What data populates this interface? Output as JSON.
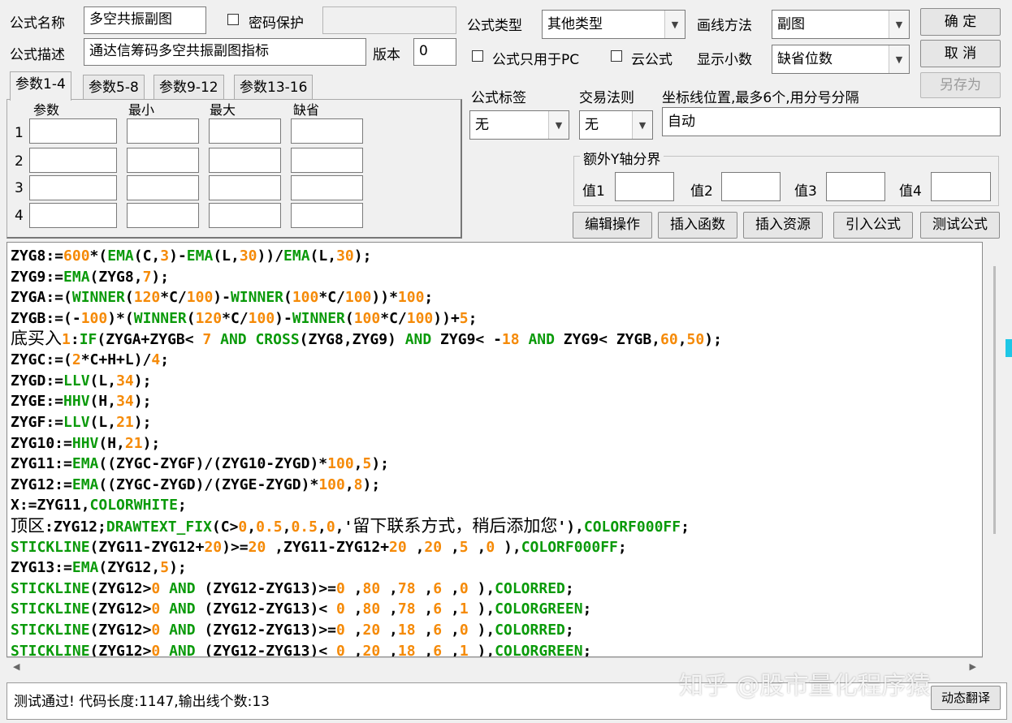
{
  "formula": {
    "name_label": "公式名称",
    "name_value": "多空共振副图",
    "password_label": "密码保护",
    "desc_label": "公式描述",
    "desc_value": "通达信筹码多空共振副图指标",
    "version_label": "版本",
    "version_value": "0",
    "type_label": "公式类型",
    "type_value": "其他类型",
    "draw_label": "画线方法",
    "draw_value": "副图",
    "pc_only_label": "公式只用于PC",
    "cloud_label": "云公式",
    "decimals_label": "显示小数",
    "decimals_value": "缺省位数",
    "tag_label": "公式标签",
    "tag_value": "无",
    "rule_label": "交易法则",
    "rule_value": "无",
    "axis_label": "坐标线位置,最多6个,用分号分隔",
    "axis_value": "自动",
    "yaxis_group": "额外Y轴分界",
    "y1": "值1",
    "y2": "值2",
    "y3": "值3",
    "y4": "值4"
  },
  "buttons": {
    "ok": "确 定",
    "cancel": "取 消",
    "save_as": "另存为",
    "edit": "编辑操作",
    "insert_func": "插入函数",
    "insert_res": "插入资源",
    "import": "引入公式",
    "test": "测试公式",
    "dynamic": "动态翻译"
  },
  "params": {
    "tabs": [
      "参数1-4",
      "参数5-8",
      "参数9-12",
      "参数13-16"
    ],
    "headers": [
      "参数",
      "最小",
      "最大",
      "缺省"
    ],
    "rows": [
      "1",
      "2",
      "3",
      "4"
    ]
  },
  "status": "测试通过! 代码长度:1147,输出线个数:13",
  "watermark": "知乎 @股市量化程序猿",
  "colors": {
    "keyword": "#0a9a0a",
    "number": "#f58a07"
  },
  "code": [
    "ZYG8:=600*(EMA(C,3)-EMA(L,30))/EMA(L,30);",
    "ZYG9:=EMA(ZYG8,7);",
    "ZYGA:=(WINNER(120*C/100)-WINNER(100*C/100))*100;",
    "ZYGB:=(-100)*(WINNER(120*C/100)-WINNER(100*C/100))+5;",
    "底买入1:IF(ZYGA+ZYGB< 7 AND CROSS(ZYG8,ZYG9) AND ZYG9< -18 AND ZYG9< ZYGB,60,50);",
    "ZYGC:=(2*C+H+L)/4;",
    "ZYGD:=LLV(L,34);",
    "ZYGE:=HHV(H,34);",
    "ZYGF:=LLV(L,21);",
    "ZYG10:=HHV(H,21);",
    "ZYG11:=EMA((ZYGC-ZYGF)/(ZYG10-ZYGD)*100,5);",
    "ZYG12:=EMA((ZYGC-ZYGD)/(ZYGE-ZYGD)*100,8);",
    "X:=ZYG11,COLORWHITE;",
    "顶区:ZYG12;DRAWTEXT_FIX(C>0,0.5,0.5,0,'留下联系方式，稍后添加您'),COLORF000FF;",
    "STICKLINE(ZYG11-ZYG12+20)>=20 ,ZYG11-ZYG12+20 ,20 ,5 ,0 ),COLORF000FF;",
    "ZYG13:=EMA(ZYG12,5);",
    "STICKLINE(ZYG12>0 AND (ZYG12-ZYG13)>=0 ,80 ,78 ,6 ,0 ),COLORRED;",
    "STICKLINE(ZYG12>0 AND (ZYG12-ZYG13)< 0 ,80 ,78 ,6 ,1 ),COLORGREEN;",
    "STICKLINE(ZYG12>0 AND (ZYG12-ZYG13)>=0 ,20 ,18 ,6 ,0 ),COLORRED;",
    "STICKLINE(ZYG12>0 AND (ZYG12-ZYG13)< 0 ,20 ,18 ,6 ,1 ),COLORGREEN;"
  ]
}
